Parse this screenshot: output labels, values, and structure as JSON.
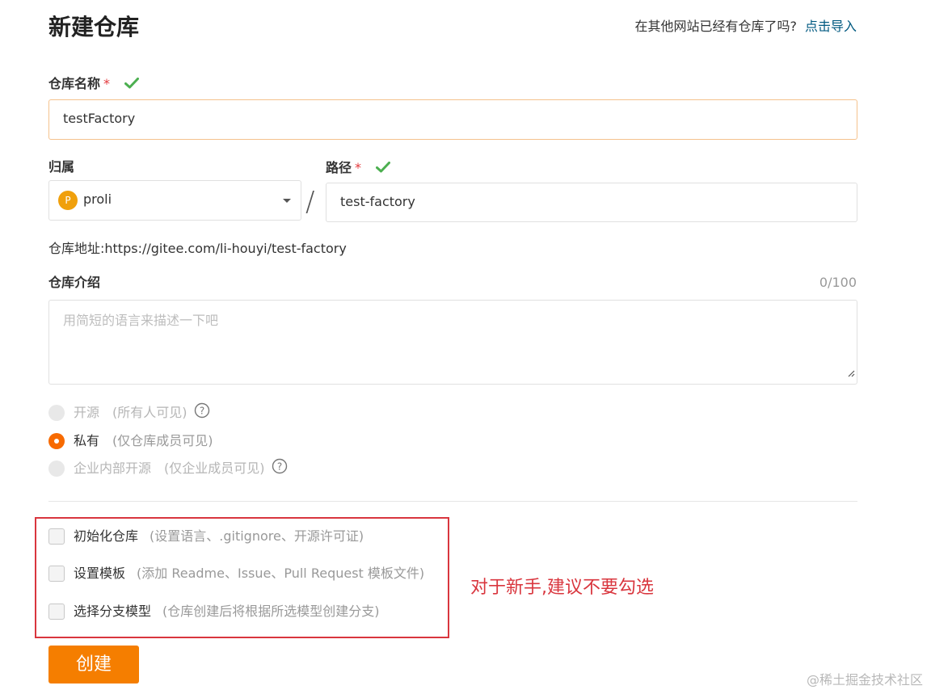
{
  "header": {
    "title": "新建仓库",
    "import_prompt": "在其他网站已经有仓库了吗?",
    "import_link": "点击导入"
  },
  "repo_name": {
    "label": "仓库名称",
    "required_mark": "*",
    "value": "testFactory",
    "valid": true
  },
  "owner": {
    "label": "归属",
    "avatar_letter": "P",
    "value": "proli"
  },
  "path": {
    "separator": "/",
    "label": "路径",
    "required_mark": "*",
    "value": "test-factory",
    "valid": true
  },
  "address": {
    "text": "仓库地址:https://gitee.com/li-houyi/test-factory"
  },
  "description": {
    "label": "仓库介绍",
    "counter": "0/100",
    "placeholder": "用简短的语言来描述一下吧"
  },
  "visibility": [
    {
      "label": "开源",
      "hint": "(所有人可见)",
      "selected": false,
      "disabled": true,
      "help": true
    },
    {
      "label": "私有",
      "hint": "(仅仓库成员可见)",
      "selected": true,
      "disabled": false,
      "help": false
    },
    {
      "label": "企业内部开源",
      "hint": "(仅企业成员可见)",
      "selected": false,
      "disabled": true,
      "help": true
    }
  ],
  "options": [
    {
      "label": "初始化仓库",
      "hint": "(设置语言、.gitignore、开源许可证)",
      "checked": false
    },
    {
      "label": "设置模板",
      "hint": "(添加 Readme、Issue、Pull Request 模板文件)",
      "checked": false
    },
    {
      "label": "选择分支模型",
      "hint": "(仓库创建后将根据所选模型创建分支)",
      "checked": false
    }
  ],
  "annotation": {
    "text": "对于新手,建议不要勾选"
  },
  "submit": {
    "label": "创建"
  },
  "watermark": {
    "text": "@稀土掘金技术社区"
  },
  "colors": {
    "accent": "#f57e00",
    "link": "#005980",
    "valid_check": "#4caf50",
    "required": "#e4393c",
    "annotation": "#d9363e"
  }
}
